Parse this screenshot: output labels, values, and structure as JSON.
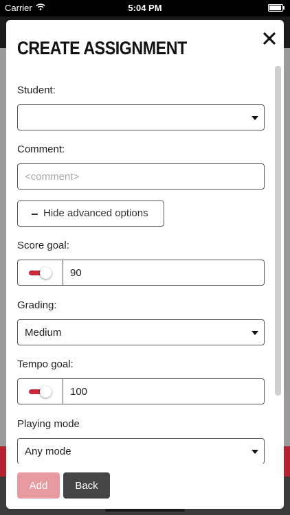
{
  "status_bar": {
    "carrier": "Carrier",
    "time": "5:04 PM"
  },
  "modal": {
    "title": "CREATE ASSIGNMENT",
    "close_icon": "close-icon"
  },
  "form": {
    "student": {
      "label": "Student:",
      "value": ""
    },
    "comment": {
      "label": "Comment:",
      "placeholder": "<comment>",
      "value": ""
    },
    "advanced_toggle": {
      "label": "Hide advanced options"
    },
    "score_goal": {
      "label": "Score goal:",
      "value": "90",
      "enabled": true
    },
    "grading": {
      "label": "Grading:",
      "value": "Medium"
    },
    "tempo_goal": {
      "label": "Tempo goal:",
      "value": "100",
      "enabled": true
    },
    "playing_mode": {
      "label": "Playing mode",
      "value": "Any mode"
    }
  },
  "footer": {
    "add_label": "Add",
    "back_label": "Back"
  },
  "colors": {
    "accent": "#c8283a",
    "add_disabled": "#e89aa1",
    "back": "#454545"
  }
}
